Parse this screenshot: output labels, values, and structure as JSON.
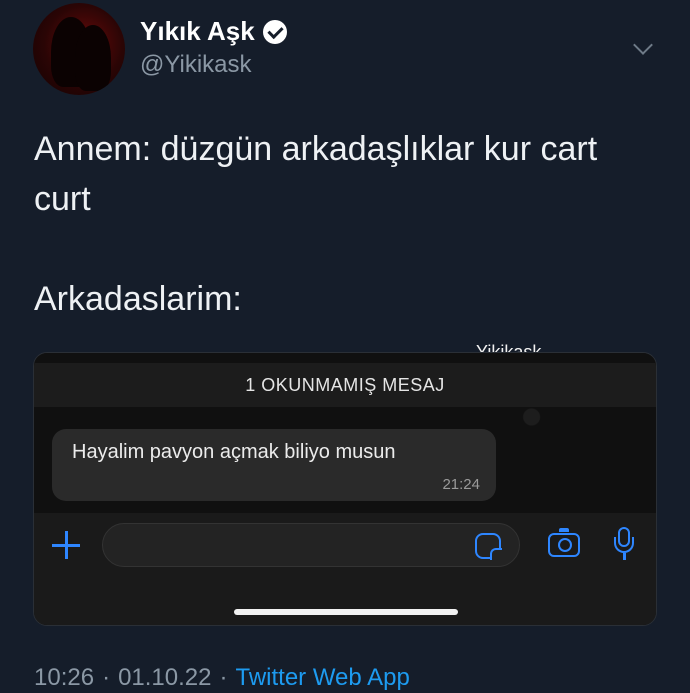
{
  "user": {
    "display_name": "Yıkık Aşk",
    "handle": "@Yikikask"
  },
  "tweet": {
    "text": "Annem: düzgün arkadaşlıklar kur cart\ncurt\n\nArkadaslarim:",
    "time": "10:26",
    "separator": "·",
    "date": "01.10.22",
    "source": "Twitter Web App"
  },
  "attachment": {
    "watermark": "Yikikask",
    "unread_banner": "1 OKUNMAMIŞ MESAJ",
    "message": {
      "text": "Hayalim pavyon açmak biliyo musun",
      "time": "21:24"
    },
    "icons": [
      "plus-icon",
      "sticker-icon",
      "camera-icon",
      "microphone-icon"
    ],
    "accent_color": "#2e86ff"
  },
  "colors": {
    "background": "#151d2a",
    "secondary_text": "#8b98a5",
    "link": "#1d9bf0"
  }
}
